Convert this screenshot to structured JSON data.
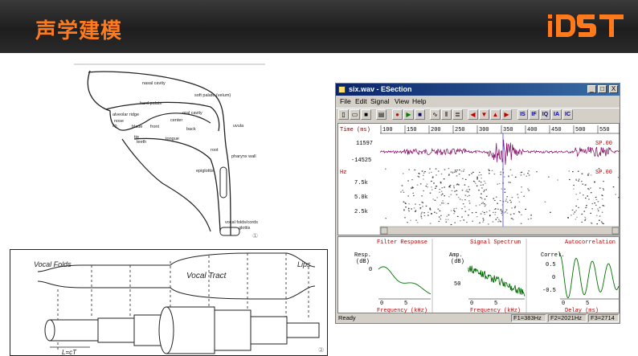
{
  "slide": {
    "title": "声学建模",
    "logo": "iDST",
    "accent_color": "#ff7a1c"
  },
  "anatomy": {
    "labels": [
      "nasal cavity",
      "soft palate (velum)",
      "hard palate",
      "oral cavity",
      "alveolar ridge",
      "center",
      "nose",
      "blade",
      "front",
      "back",
      "lip",
      "tip",
      "teeth",
      "tongue",
      "uvula",
      "root",
      "pharynx wall",
      "epiglottis",
      "vocal folds/cords",
      "glottis"
    ],
    "footnote": "①"
  },
  "tube_model": {
    "label_left": "Vocal Folds",
    "label_center": "Vocal Tract",
    "label_right": "Lips",
    "formula": "L=cT",
    "footnote": "②"
  },
  "esection": {
    "window_title": "six.wav - ESection",
    "title_buttons": [
      "_",
      "□",
      "X"
    ],
    "menu": [
      "File",
      "Edit",
      "Signal",
      "View",
      "Help"
    ],
    "toolbar_text_buttons": [
      "IS",
      "IF",
      "IQ",
      "IA",
      "IC"
    ],
    "time_axis_label": "Time (ms)",
    "time_ticks": [
      "100",
      "150",
      "200",
      "250",
      "300",
      "350",
      "400",
      "450",
      "500",
      "550"
    ],
    "wave_max": "11597",
    "wave_min": "-14525",
    "wave_tag": "SP.00",
    "spec_unit": "Hz",
    "spec_tag": "SP.00",
    "spec_ticks": [
      "7.5k",
      "5.0k",
      "2.5k"
    ],
    "panels": [
      {
        "title": "Filter Response",
        "ylabel": "Resp.",
        "yunit": "(dB)",
        "yticks": [
          "0"
        ],
        "xticks": [
          "0",
          "5"
        ],
        "xlabel": "Frequency (kHz)"
      },
      {
        "title": "Signal Spectrum",
        "ylabel": "Amp.",
        "yunit": "(dB)",
        "yticks": [
          "50"
        ],
        "xticks": [
          "0",
          "5"
        ],
        "xlabel": "Frequency (kHz)"
      },
      {
        "title": "Autocorrelation",
        "ylabel": "Correl.",
        "yunit": "",
        "yticks": [
          "0.5",
          "0",
          "-0.5"
        ],
        "xticks": [
          "0",
          "5"
        ],
        "xlabel": "Delay (ms)"
      }
    ],
    "status": {
      "ready": "Ready",
      "f1": "F1=383Hz",
      "f2": "F2=2021Hz",
      "f3": "F3=2714"
    }
  }
}
